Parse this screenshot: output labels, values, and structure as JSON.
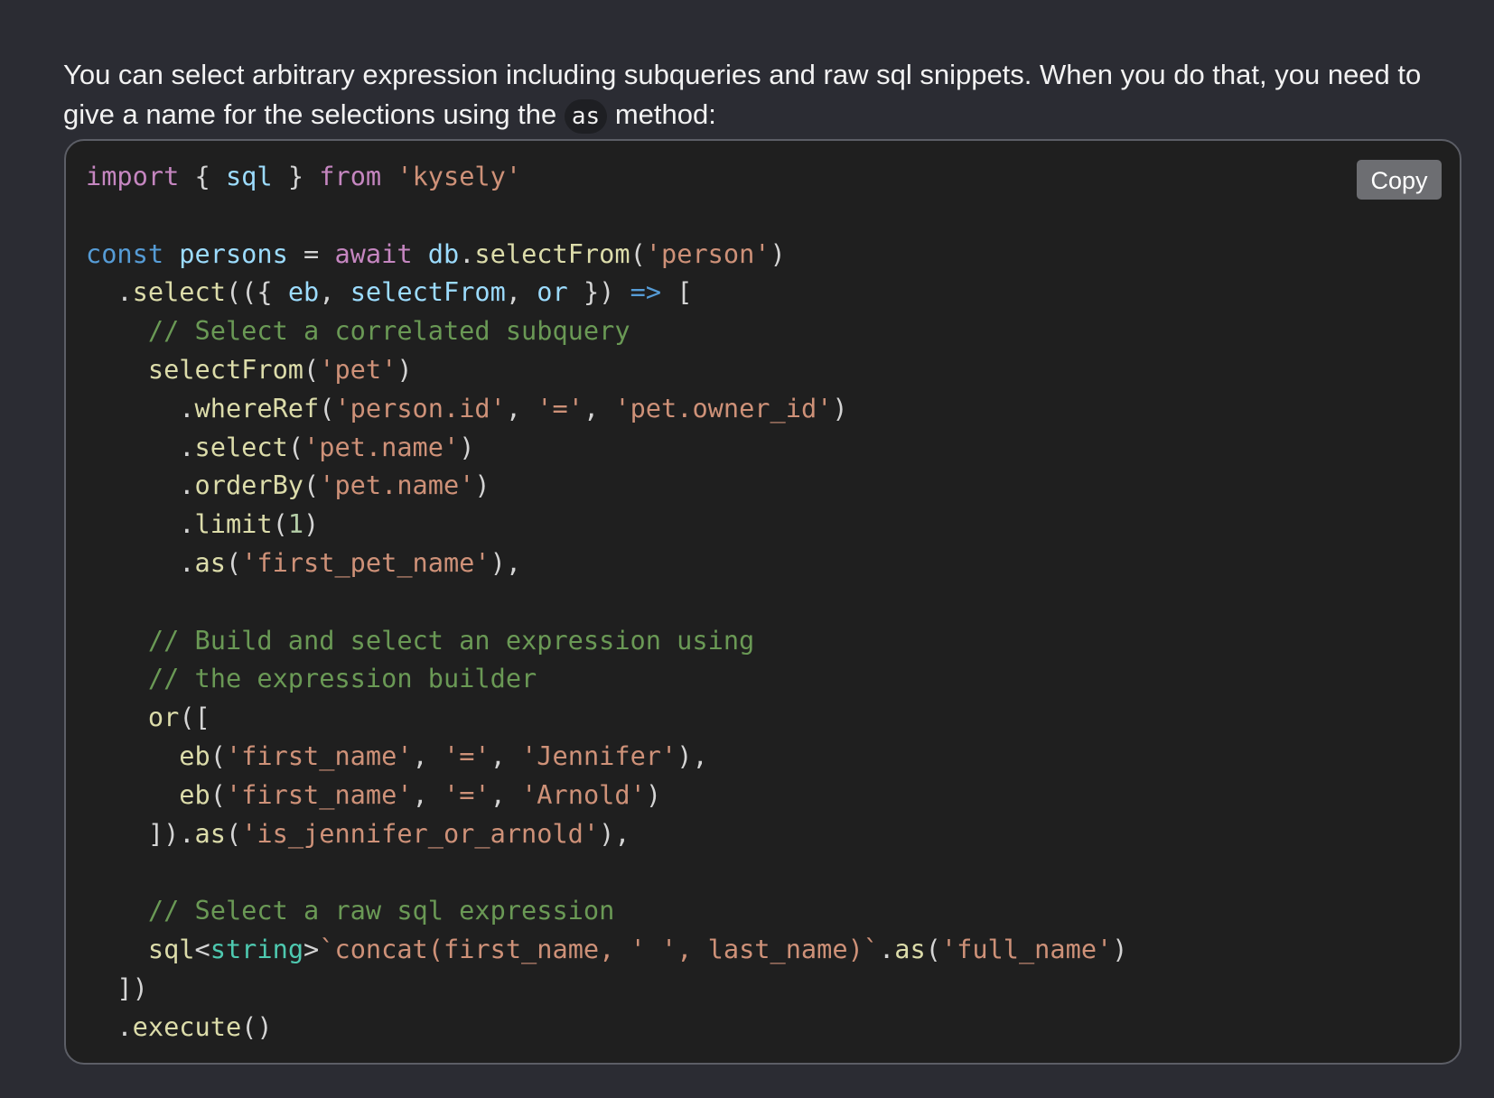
{
  "paragraph": {
    "text_before": "You can select arbitrary expression including subqueries and raw sql snippets. When you do that, you need to give a name for the selections using the ",
    "inline_code": "as",
    "text_after": " method:"
  },
  "code_block": {
    "copy_label": "Copy",
    "language": "typescript",
    "lines": [
      [
        [
          "kw",
          "import"
        ],
        [
          "pun",
          " { "
        ],
        [
          "var",
          "sql"
        ],
        [
          "pun",
          " } "
        ],
        [
          "kw",
          "from"
        ],
        [
          "pun",
          " "
        ],
        [
          "str",
          "'kysely'"
        ]
      ],
      [],
      [
        [
          "dkw",
          "const"
        ],
        [
          "pun",
          " "
        ],
        [
          "var",
          "persons"
        ],
        [
          "pun",
          " = "
        ],
        [
          "kw",
          "await"
        ],
        [
          "pun",
          " "
        ],
        [
          "var",
          "db"
        ],
        [
          "pun",
          "."
        ],
        [
          "fn",
          "selectFrom"
        ],
        [
          "pun",
          "("
        ],
        [
          "str",
          "'person'"
        ],
        [
          "pun",
          ")"
        ]
      ],
      [
        [
          "pun",
          "  ."
        ],
        [
          "fn",
          "select"
        ],
        [
          "pun",
          "(({ "
        ],
        [
          "var",
          "eb"
        ],
        [
          "pun",
          ", "
        ],
        [
          "var",
          "selectFrom"
        ],
        [
          "pun",
          ", "
        ],
        [
          "var",
          "or"
        ],
        [
          "pun",
          " }) "
        ],
        [
          "dkw",
          "=>"
        ],
        [
          "pun",
          " ["
        ]
      ],
      [
        [
          "pun",
          "    "
        ],
        [
          "cmt",
          "// Select a correlated subquery"
        ]
      ],
      [
        [
          "pun",
          "    "
        ],
        [
          "fn",
          "selectFrom"
        ],
        [
          "pun",
          "("
        ],
        [
          "str",
          "'pet'"
        ],
        [
          "pun",
          ")"
        ]
      ],
      [
        [
          "pun",
          "      ."
        ],
        [
          "fn",
          "whereRef"
        ],
        [
          "pun",
          "("
        ],
        [
          "str",
          "'person.id'"
        ],
        [
          "pun",
          ", "
        ],
        [
          "str",
          "'='"
        ],
        [
          "pun",
          ", "
        ],
        [
          "str",
          "'pet.owner_id'"
        ],
        [
          "pun",
          ")"
        ]
      ],
      [
        [
          "pun",
          "      ."
        ],
        [
          "fn",
          "select"
        ],
        [
          "pun",
          "("
        ],
        [
          "str",
          "'pet.name'"
        ],
        [
          "pun",
          ")"
        ]
      ],
      [
        [
          "pun",
          "      ."
        ],
        [
          "fn",
          "orderBy"
        ],
        [
          "pun",
          "("
        ],
        [
          "str",
          "'pet.name'"
        ],
        [
          "pun",
          ")"
        ]
      ],
      [
        [
          "pun",
          "      ."
        ],
        [
          "fn",
          "limit"
        ],
        [
          "pun",
          "("
        ],
        [
          "num",
          "1"
        ],
        [
          "pun",
          ")"
        ]
      ],
      [
        [
          "pun",
          "      ."
        ],
        [
          "fn",
          "as"
        ],
        [
          "pun",
          "("
        ],
        [
          "str",
          "'first_pet_name'"
        ],
        [
          "pun",
          "),"
        ]
      ],
      [],
      [
        [
          "pun",
          "    "
        ],
        [
          "cmt",
          "// Build and select an expression using"
        ]
      ],
      [
        [
          "pun",
          "    "
        ],
        [
          "cmt",
          "// the expression builder"
        ]
      ],
      [
        [
          "pun",
          "    "
        ],
        [
          "fn",
          "or"
        ],
        [
          "pun",
          "(["
        ]
      ],
      [
        [
          "pun",
          "      "
        ],
        [
          "fn",
          "eb"
        ],
        [
          "pun",
          "("
        ],
        [
          "str",
          "'first_name'"
        ],
        [
          "pun",
          ", "
        ],
        [
          "str",
          "'='"
        ],
        [
          "pun",
          ", "
        ],
        [
          "str",
          "'Jennifer'"
        ],
        [
          "pun",
          "),"
        ]
      ],
      [
        [
          "pun",
          "      "
        ],
        [
          "fn",
          "eb"
        ],
        [
          "pun",
          "("
        ],
        [
          "str",
          "'first_name'"
        ],
        [
          "pun",
          ", "
        ],
        [
          "str",
          "'='"
        ],
        [
          "pun",
          ", "
        ],
        [
          "str",
          "'Arnold'"
        ],
        [
          "pun",
          ")"
        ]
      ],
      [
        [
          "pun",
          "    ])."
        ],
        [
          "fn",
          "as"
        ],
        [
          "pun",
          "("
        ],
        [
          "str",
          "'is_jennifer_or_arnold'"
        ],
        [
          "pun",
          "),"
        ]
      ],
      [],
      [
        [
          "pun",
          "    "
        ],
        [
          "cmt",
          "// Select a raw sql expression"
        ]
      ],
      [
        [
          "pun",
          "    "
        ],
        [
          "fn",
          "sql"
        ],
        [
          "pun",
          "<"
        ],
        [
          "typ",
          "string"
        ],
        [
          "pun",
          ">"
        ],
        [
          "str",
          "`concat(first_name, ' ', last_name)`"
        ],
        [
          "pun",
          "."
        ],
        [
          "fn",
          "as"
        ],
        [
          "pun",
          "("
        ],
        [
          "str",
          "'full_name'"
        ],
        [
          "pun",
          ")"
        ]
      ],
      [
        [
          "pun",
          "  ])"
        ]
      ],
      [
        [
          "pun",
          "  ."
        ],
        [
          "fn",
          "execute"
        ],
        [
          "pun",
          "()"
        ]
      ]
    ]
  }
}
